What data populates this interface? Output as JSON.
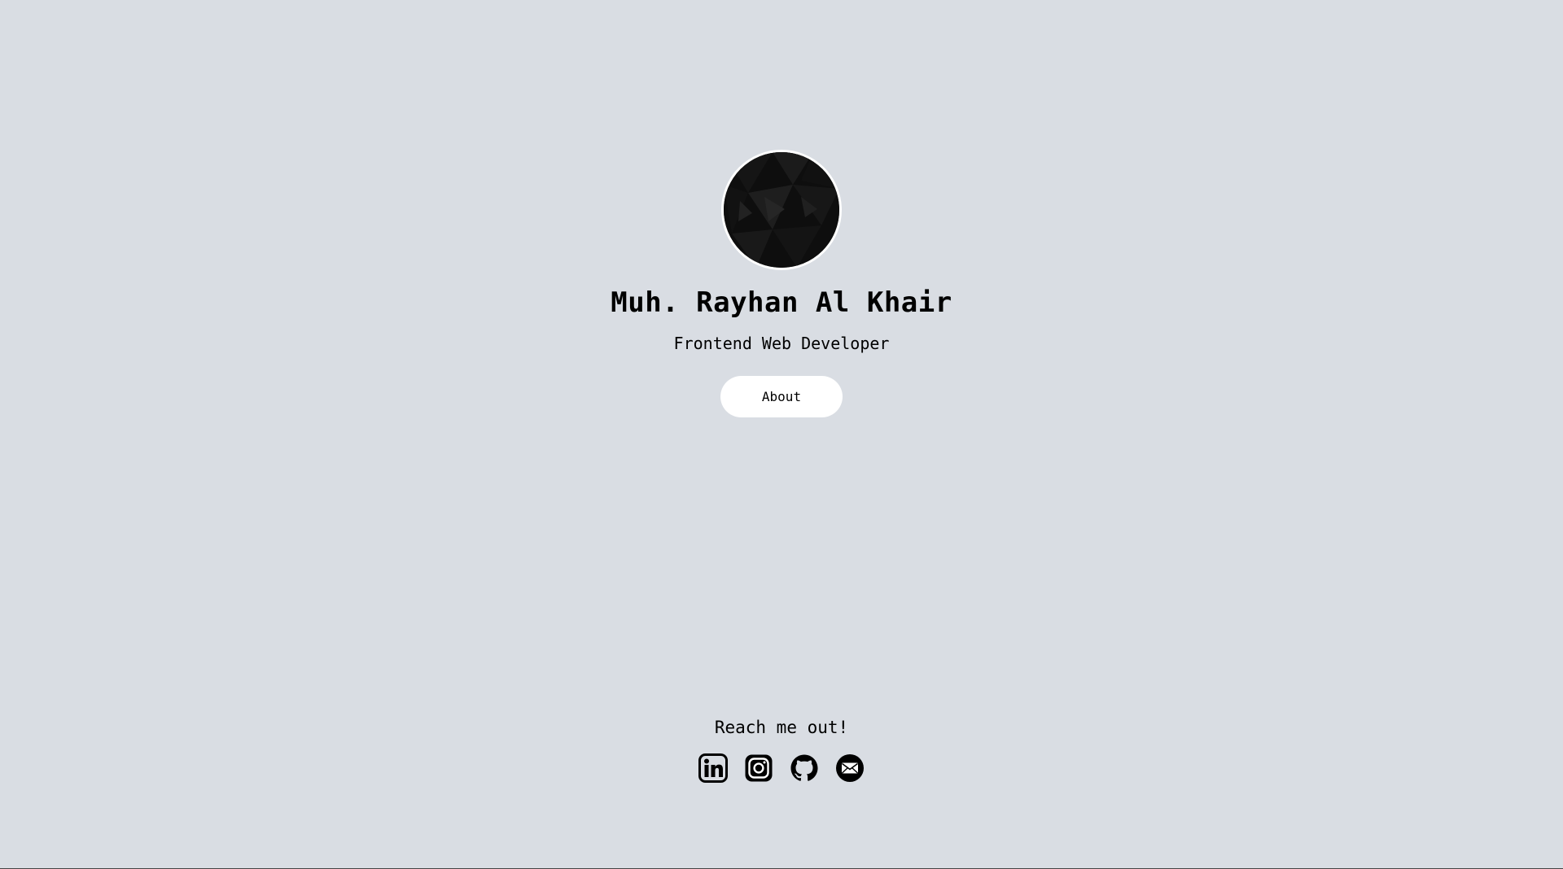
{
  "profile": {
    "name": "Muh. Rayhan Al Khair",
    "role": "Frontend Web Developer",
    "about_label": "About"
  },
  "footer": {
    "heading": "Reach me out!",
    "socials": [
      {
        "icon": "linkedin-icon"
      },
      {
        "icon": "instagram-icon"
      },
      {
        "icon": "github-icon"
      },
      {
        "icon": "email-icon"
      }
    ]
  },
  "colors": {
    "background": "#d9dde3",
    "button": "#ffffff",
    "text": "#000000"
  }
}
